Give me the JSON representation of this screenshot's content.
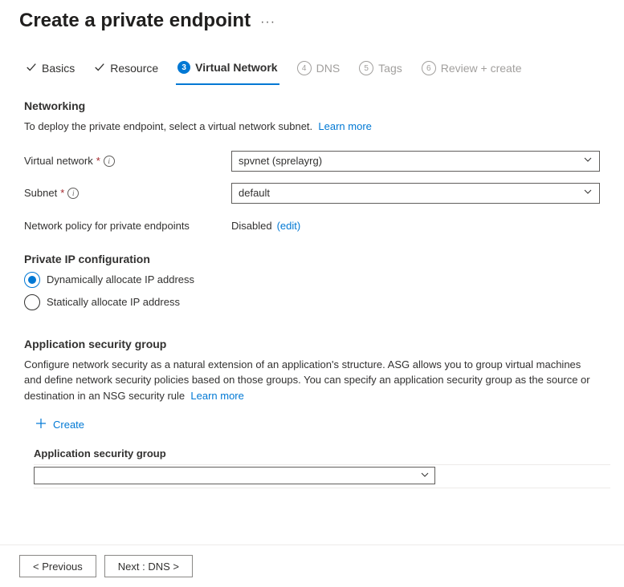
{
  "header": {
    "title": "Create a private endpoint"
  },
  "tabs": {
    "basics": "Basics",
    "resource": "Resource",
    "virtual_network_num": "3",
    "virtual_network": "Virtual Network",
    "dns_num": "4",
    "dns": "DNS",
    "tags_num": "5",
    "tags": "Tags",
    "review_num": "6",
    "review": "Review + create"
  },
  "networking": {
    "heading": "Networking",
    "description": "To deploy the private endpoint, select a virtual network subnet.",
    "learn_more": "Learn more",
    "virtual_network_label": "Virtual network",
    "virtual_network_value": "spvnet (sprelayrg)",
    "subnet_label": "Subnet",
    "subnet_value": "default",
    "policy_label": "Network policy for private endpoints",
    "policy_value": "Disabled",
    "policy_edit": "(edit)"
  },
  "ip_config": {
    "heading": "Private IP configuration",
    "dynamic": "Dynamically allocate IP address",
    "static": "Statically allocate IP address"
  },
  "asg": {
    "heading": "Application security group",
    "description": "Configure network security as a natural extension of an application's structure. ASG allows you to group virtual machines and define network security policies based on those groups. You can specify an application security group as the source or destination in an NSG security rule",
    "learn_more": "Learn more",
    "create": "Create",
    "column_header": "Application security group",
    "select_value": ""
  },
  "footer": {
    "previous": "<  Previous",
    "next": "Next : DNS  >"
  }
}
